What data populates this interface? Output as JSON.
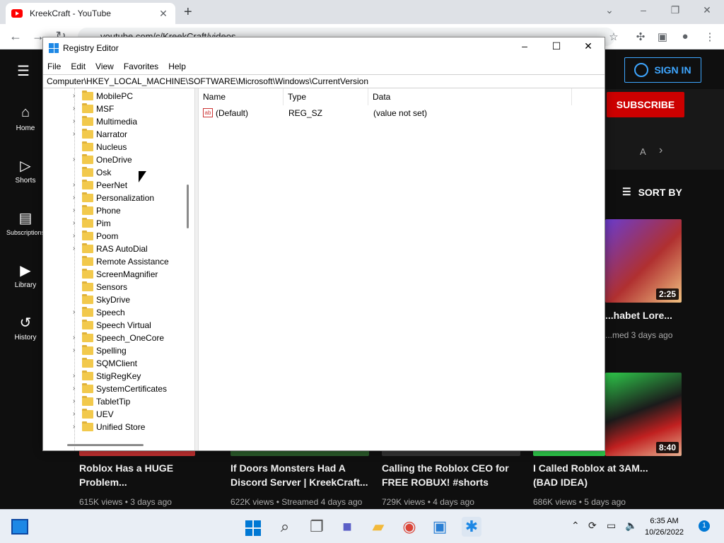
{
  "browser": {
    "tab_title": "KreekCraft - YouTube",
    "url": "youtube.com/c/KreekCraft/videos"
  },
  "youtube": {
    "signin_label": "SIGN IN",
    "subscribe_label": "SUBSCRIBE",
    "tab_fragment": "A",
    "sort_label": "SORT BY",
    "sidebar": [
      {
        "label": "Home",
        "icon": "home-icon"
      },
      {
        "label": "Shorts",
        "icon": "shorts-icon"
      },
      {
        "label": "Subscriptions",
        "icon": "subscriptions-icon"
      },
      {
        "label": "Library",
        "icon": "library-icon"
      },
      {
        "label": "History",
        "icon": "history-icon"
      }
    ],
    "side_videos": [
      {
        "title": "...habet Lore...",
        "meta": "...med 3 days ago",
        "duration": "2:25"
      },
      {
        "duration": "8:40"
      }
    ],
    "videos": [
      {
        "title": "Roblox Has a HUGE Problem...",
        "meta": "615K views • 3 days ago"
      },
      {
        "title": "If Doors Monsters Had A Discord Server | KreekCraft...",
        "meta": "622K views • Streamed 4 days ago"
      },
      {
        "title": "Calling the Roblox CEO for FREE ROBUX! #shorts",
        "meta": "729K views • 4 days ago"
      },
      {
        "title": "I Called Roblox at 3AM... (BAD IDEA)",
        "meta": "686K views • 5 days ago"
      }
    ]
  },
  "regedit": {
    "title": "Registry Editor",
    "menu": [
      "File",
      "Edit",
      "View",
      "Favorites",
      "Help"
    ],
    "address": "Computer\\HKEY_LOCAL_MACHINE\\SOFTWARE\\Microsoft\\Windows\\CurrentVersion",
    "tree": [
      {
        "label": "MobilePC",
        "expandable": true
      },
      {
        "label": "MSF",
        "expandable": true
      },
      {
        "label": "Multimedia",
        "expandable": true
      },
      {
        "label": "Narrator",
        "expandable": true
      },
      {
        "label": "Nucleus",
        "expandable": false
      },
      {
        "label": "OneDrive",
        "expandable": true
      },
      {
        "label": "Osk",
        "expandable": false
      },
      {
        "label": "PeerNet",
        "expandable": true
      },
      {
        "label": "Personalization",
        "expandable": true
      },
      {
        "label": "Phone",
        "expandable": true
      },
      {
        "label": "Pim",
        "expandable": true
      },
      {
        "label": "Poom",
        "expandable": true
      },
      {
        "label": "RAS AutoDial",
        "expandable": true
      },
      {
        "label": "Remote Assistance",
        "expandable": false
      },
      {
        "label": "ScreenMagnifier",
        "expandable": false
      },
      {
        "label": "Sensors",
        "expandable": false
      },
      {
        "label": "SkyDrive",
        "expandable": false
      },
      {
        "label": "Speech",
        "expandable": true
      },
      {
        "label": "Speech Virtual",
        "expandable": false
      },
      {
        "label": "Speech_OneCore",
        "expandable": true
      },
      {
        "label": "Spelling",
        "expandable": true
      },
      {
        "label": "SQMClient",
        "expandable": false
      },
      {
        "label": "StigRegKey",
        "expandable": true
      },
      {
        "label": "SystemCertificates",
        "expandable": true
      },
      {
        "label": "TabletTip",
        "expandable": true
      },
      {
        "label": "UEV",
        "expandable": true
      },
      {
        "label": "Unified Store",
        "expandable": true
      }
    ],
    "columns": [
      "Name",
      "Type",
      "Data"
    ],
    "values": [
      {
        "name": "(Default)",
        "type": "REG_SZ",
        "data": "(value not set)"
      }
    ]
  },
  "taskbar": {
    "time": "6:35 AM",
    "date": "10/26/2022",
    "notifications": "1"
  }
}
